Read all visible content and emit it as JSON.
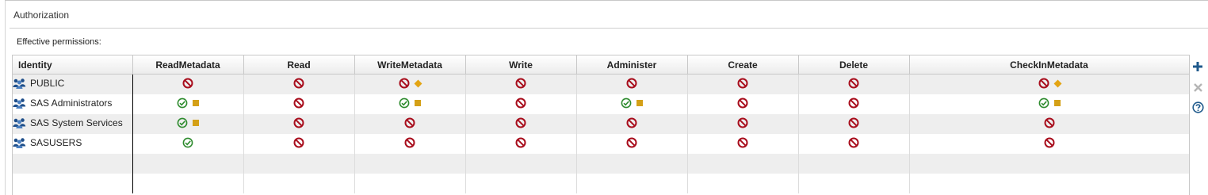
{
  "panel": {
    "title": "Authorization"
  },
  "section": {
    "label": "Effective permissions:"
  },
  "table": {
    "columns": [
      "Identity",
      "ReadMetadata",
      "Read",
      "WriteMetadata",
      "Write",
      "Administer",
      "Create",
      "Delete",
      "CheckInMetadata"
    ],
    "rows": [
      {
        "identity": "PUBLIC",
        "icon": "group-icon",
        "permissions": [
          {
            "state": "deny",
            "marker": "none"
          },
          {
            "state": "deny",
            "marker": "none"
          },
          {
            "state": "deny",
            "marker": "diamond"
          },
          {
            "state": "deny",
            "marker": "none"
          },
          {
            "state": "deny",
            "marker": "none"
          },
          {
            "state": "deny",
            "marker": "none"
          },
          {
            "state": "deny",
            "marker": "none"
          },
          {
            "state": "deny",
            "marker": "diamond"
          }
        ]
      },
      {
        "identity": "SAS Administrators",
        "icon": "group-icon",
        "permissions": [
          {
            "state": "grant",
            "marker": "square"
          },
          {
            "state": "deny",
            "marker": "none"
          },
          {
            "state": "grant",
            "marker": "square"
          },
          {
            "state": "deny",
            "marker": "none"
          },
          {
            "state": "grant",
            "marker": "square"
          },
          {
            "state": "deny",
            "marker": "none"
          },
          {
            "state": "deny",
            "marker": "none"
          },
          {
            "state": "grant",
            "marker": "square"
          }
        ]
      },
      {
        "identity": "SAS System Services",
        "icon": "group-icon",
        "permissions": [
          {
            "state": "grant",
            "marker": "square"
          },
          {
            "state": "deny",
            "marker": "none"
          },
          {
            "state": "deny",
            "marker": "none"
          },
          {
            "state": "deny",
            "marker": "none"
          },
          {
            "state": "deny",
            "marker": "none"
          },
          {
            "state": "deny",
            "marker": "none"
          },
          {
            "state": "deny",
            "marker": "none"
          },
          {
            "state": "deny",
            "marker": "none"
          }
        ]
      },
      {
        "identity": "SASUSERS",
        "icon": "group-icon",
        "permissions": [
          {
            "state": "grant",
            "marker": "none"
          },
          {
            "state": "deny",
            "marker": "none"
          },
          {
            "state": "deny",
            "marker": "none"
          },
          {
            "state": "deny",
            "marker": "none"
          },
          {
            "state": "deny",
            "marker": "none"
          },
          {
            "state": "deny",
            "marker": "none"
          },
          {
            "state": "deny",
            "marker": "none"
          },
          {
            "state": "deny",
            "marker": "none"
          }
        ]
      }
    ],
    "empty_rows": 2
  },
  "toolbar": {
    "buttons": [
      {
        "name": "add-button",
        "icon": "plus-icon",
        "enabled": true
      },
      {
        "name": "remove-button",
        "icon": "close-icon",
        "enabled": false
      },
      {
        "name": "help-button",
        "icon": "help-icon",
        "enabled": true
      }
    ]
  },
  "colors": {
    "grant": "#2e8b2e",
    "deny": "#a80d1c",
    "explicit_square": "#d4a017",
    "conditional_diamond": "#e3a412",
    "tool_blue": "#1f5a8c",
    "tool_disabled": "#b5b5b5"
  }
}
